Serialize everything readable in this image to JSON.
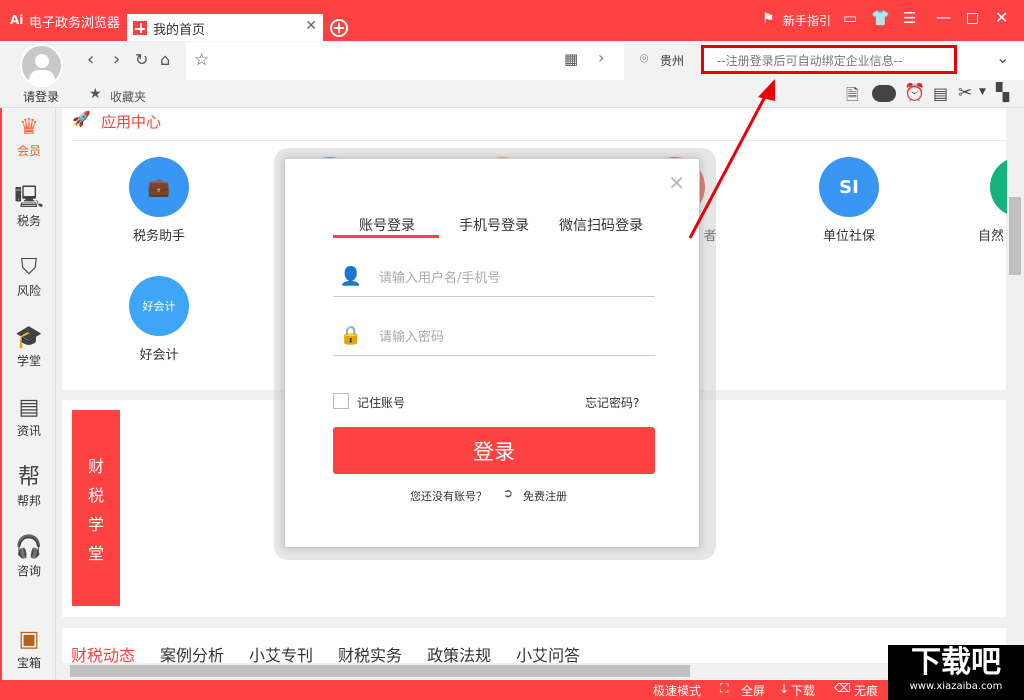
{
  "titlebar": {
    "logo": "Ai",
    "app_name": "电子政务浏览器",
    "tab_label": "我的首页",
    "guide": "新手指引"
  },
  "toolbar": {
    "login": "请登录",
    "favorites": "收藏夹",
    "location": "贵州",
    "enterprise_placeholder": "--注册登录后可自动绑定企业信息--"
  },
  "sidebar": {
    "items": [
      {
        "label": "会员",
        "icon": "vip-crown-icon"
      },
      {
        "label": "税务",
        "icon": "tax-monitor-icon"
      },
      {
        "label": "风险",
        "icon": "shield-icon"
      },
      {
        "label": "学堂",
        "icon": "graduation-cap-icon"
      },
      {
        "label": "资讯",
        "icon": "news-icon"
      },
      {
        "label": "帮邦",
        "icon": "help-icon"
      },
      {
        "label": "咨询",
        "icon": "headset-icon"
      },
      {
        "label": "宝箱",
        "icon": "treasure-chest-icon"
      }
    ]
  },
  "app_center": {
    "title": "应用中心",
    "apps": [
      {
        "label": "税务助手",
        "color": "#3a96f5"
      },
      {
        "label": "单位社保",
        "color": "#3a96f5"
      },
      {
        "label": "自然",
        "color": "#14b37d"
      },
      {
        "label": "好会计",
        "color": "#3ea6f8"
      },
      {
        "label": "者",
        "color": "#ee4433"
      }
    ]
  },
  "school": {
    "title_chars": [
      "财",
      "税",
      "学",
      "堂"
    ]
  },
  "news_tabs": [
    "财税动态",
    "案例分析",
    "小艾专刊",
    "财税实务",
    "政策法规",
    "小艾问答"
  ],
  "login_modal": {
    "tabs": [
      "账号登录",
      "手机号登录",
      "微信扫码登录"
    ],
    "username_placeholder": "请输入用户名/手机号",
    "password_placeholder": "请输入密码",
    "remember": "记住账号",
    "forgot": "忘记密码?",
    "submit": "登录",
    "no_account": "您还没有账号？",
    "register": "免费注册"
  },
  "statusbar": {
    "speed_mode": "极速模式",
    "fullscreen": "全屏",
    "download": "下载",
    "incognito": "无痕"
  },
  "watermark": {
    "text": "下载吧",
    "url": "www.xiazaiba.com"
  },
  "colors": {
    "brand": "#fe4141",
    "accent_blue": "#3a96f5"
  }
}
